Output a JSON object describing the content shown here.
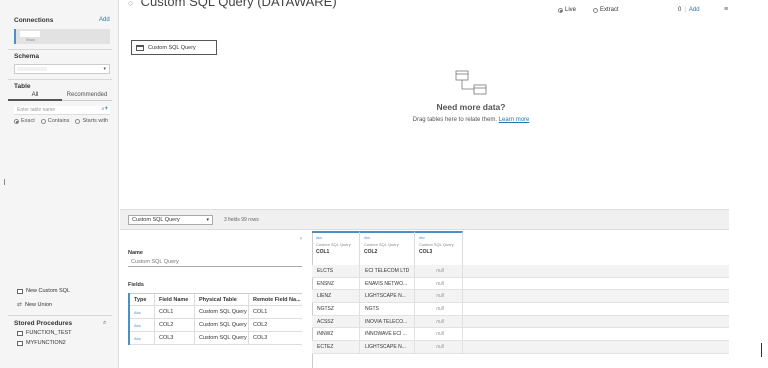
{
  "header": {
    "title": "Custom SQL Query (DATAWARE)",
    "connection_live": "Live",
    "connection_extract": "Extract",
    "filters_count": "0",
    "filters_add": "Add"
  },
  "sidebar": {
    "connections_label": "Connections",
    "connections_add": "Add",
    "connection_sub": "Snow",
    "schema_label": "Schema",
    "table_label": "Table",
    "tabs": [
      {
        "label": "All"
      },
      {
        "label": "Recommended"
      }
    ],
    "table_search_placeholder": "Enter table name",
    "match_options": [
      {
        "label": "Exact"
      },
      {
        "label": "Contains"
      },
      {
        "label": "Starts with"
      }
    ],
    "new_custom_sql": "New Custom SQL",
    "new_union": "New Union",
    "stored_procedures_label": "Stored Procedures",
    "stored_procedures": [
      {
        "label": "FUNCTION_TEST"
      },
      {
        "label": "MYFUNCTION2"
      }
    ]
  },
  "canvas": {
    "pill_label": "Custom SQL Query",
    "need_more_title": "Need more data?",
    "need_more_text": "Drag tables here to relate them.",
    "learn_more": "Learn more"
  },
  "bottom_bar": {
    "table_select": "Custom SQL Query",
    "fields_rows": "3 fields 99 rows"
  },
  "meta": {
    "name_label": "Name",
    "name_value": "Custom SQL Query",
    "fields_label": "Fields",
    "columns": [
      "Type",
      "Field Name",
      "Physical Table",
      "Remote Field Na..."
    ],
    "rows": [
      {
        "type": "Abc",
        "field": "COL1",
        "table": "Custom SQL Query",
        "remote": "COL1"
      },
      {
        "type": "Abc",
        "field": "COL2",
        "table": "Custom SQL Query",
        "remote": "COL2"
      },
      {
        "type": "Abc",
        "field": "COL3",
        "table": "Custom SQL Query",
        "remote": "COL3"
      }
    ]
  },
  "grid": {
    "columns": [
      {
        "type": "Abc",
        "source": "Custom SQL Query",
        "name": "COL1"
      },
      {
        "type": "Abc",
        "source": "Custom SQL Query",
        "name": "COL2"
      },
      {
        "type": "Abc",
        "source": "Custom SQL Query",
        "name": "COL3"
      }
    ],
    "rows": [
      [
        "ELCTS",
        "ECI TELECOM LTD",
        "null"
      ],
      [
        "ENSNZ",
        "ENAVIS NETWO...",
        "null"
      ],
      [
        "LIENZ",
        "LIGHTSCAPE N...",
        "null"
      ],
      [
        "NGTSZ",
        "NGTS",
        "null"
      ],
      [
        "ACSSZ",
        "INOVIA TELECO...",
        "null"
      ],
      [
        "INNWZ",
        "INNOWAVE ECI ...",
        "null"
      ],
      [
        "ECTEZ",
        "LIGHTSCAPE N...",
        "null"
      ]
    ]
  }
}
